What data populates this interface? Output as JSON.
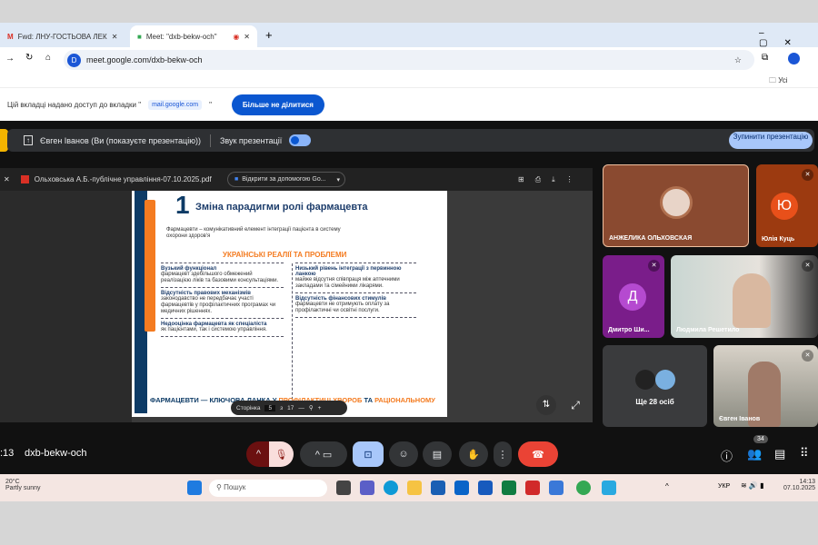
{
  "browser": {
    "tabs": [
      {
        "label": "Fwd: ЛНУ-ГОСТЬОВА ЛЕК"
      },
      {
        "label": "Meet: \"dxb-bekw-och\""
      }
    ],
    "url": "meet.google.com/dxb-bekw-och",
    "url_badge": "D",
    "bookmarks_label": "Усі закладки"
  },
  "share_info": {
    "text": "Цій вкладці надано доступ до вкладки \"",
    "chip": "mail.google.com",
    "text_end": "\"",
    "stop_button": "Більше не ділитися"
  },
  "present_bar": {
    "presenter": "Євген Іванов (Ви (показуєте презентацію))",
    "audio_label": "Звук презентації",
    "audio_on": true,
    "stop_button": "Зупинити презентацію"
  },
  "pdf": {
    "filename": "Ольховська А.Б.-публічне управління-07.10.2025.pdf",
    "open_with": "Відкрити за допомогою Go...",
    "page_label": "Сторінка",
    "page": "5",
    "of": "з",
    "total": "17"
  },
  "slide": {
    "number": "1",
    "title": "Зміна парадигми ролі фармацевта",
    "intro": "Фармацевти – комунікативний елемент інтеграції пацієнта в систему охорони здоров'я",
    "section": "УКРАЇНСЬКІ РЕАЛІЇ ТА ПРОБЛЕМИ",
    "left": [
      {
        "h": "Вузький функціонал",
        "t": "фармацевт здебільшого обмежений реалізацією ліків та базовими консультаціями."
      },
      {
        "h": "Відсутність правових механізмів",
        "t": "законодавство не передбачає участі фармацевтів у профілактичних програмах чи медичних рішеннях."
      },
      {
        "h": "Недооцінка фармацевта як спеціаліста",
        "t": "як пацієнтами, так і системою управління."
      }
    ],
    "right": [
      {
        "h": "Низький рівень інтеграції з первинною ланкою",
        "t": "майже відсутня співпраця між аптечними закладами та сімейними лікарями."
      },
      {
        "h": "Відсутність фінансових стимулів",
        "t": "фармацевти не отримують оплату за профілактичні чи освітні послуги."
      }
    ],
    "footer_a": "ФАРМАЦЕВТИ — КЛЮЧОВА ЛАНКА У ",
    "footer_b": "ПРОФІЛАКТИЦІ ХВОРОБ",
    "footer_c": " ТА ",
    "footer_d": "РАЦІОНАЛЬНОМУ"
  },
  "participants": [
    {
      "name": "АНЖЕЛИКА ОЛЬХОВСКАЯ"
    },
    {
      "name": "Юлія Куць",
      "initial": "Ю"
    },
    {
      "name": "Дмитро Ши...",
      "initial": "Д"
    },
    {
      "name": "Людмила Решетило"
    },
    {
      "name": "Євген Іванов"
    }
  ],
  "more_people": "Ще 28 осіб",
  "meeting": {
    "time": ":13",
    "code": "dxb-bekw-och",
    "participant_count": "34"
  },
  "taskbar": {
    "weather_temp": "20°C",
    "weather_desc": "Partly sunny",
    "search_placeholder": "Пошук",
    "lang": "УКР",
    "time": "14:13",
    "date": "07.10.2025"
  },
  "colors": {
    "accent": "#0b57d0",
    "end_call": "#ea4335",
    "slide_orange": "#f47b20",
    "slide_navy": "#0d3b66"
  }
}
